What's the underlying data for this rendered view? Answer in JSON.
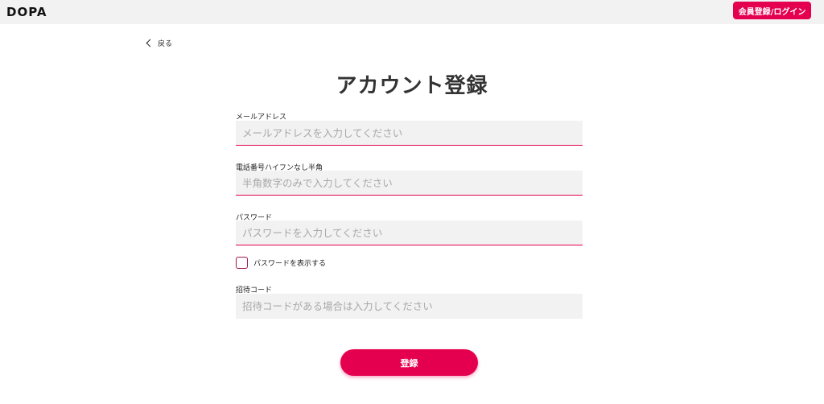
{
  "header": {
    "logo_text": "DOPA",
    "register_login_label": "会員登録/ログイン"
  },
  "nav": {
    "back_label": "戻る"
  },
  "page": {
    "title": "アカウント登録"
  },
  "form": {
    "email": {
      "label": "メールアドレス",
      "placeholder": "メールアドレスを入力してください",
      "value": ""
    },
    "phone": {
      "label": "電話番号ハイフンなし半角",
      "placeholder": "半角数字のみで入力してください",
      "value": ""
    },
    "password": {
      "label": "パスワード",
      "placeholder": "パスワードを入力してください",
      "value": ""
    },
    "show_password": {
      "label": "パスワードを表示する",
      "checked": false
    },
    "invite_code": {
      "label": "招待コード",
      "placeholder": "招待コードがある場合は入力してください",
      "value": ""
    },
    "submit_label": "登録"
  },
  "colors": {
    "accent": "#e5004f",
    "topbar_bg": "#f2f2f2",
    "field_bg": "#f2f2f2"
  }
}
